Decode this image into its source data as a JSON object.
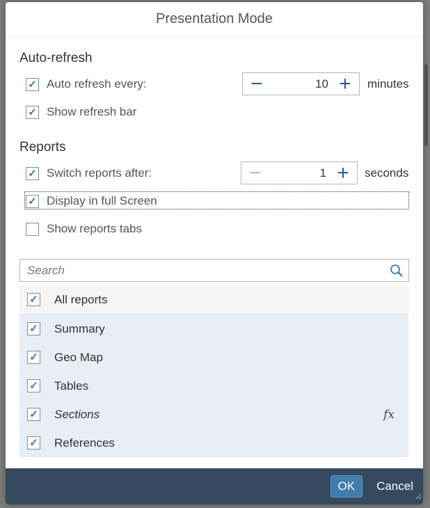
{
  "dialog": {
    "title": "Presentation Mode"
  },
  "auto_refresh": {
    "section_title": "Auto-refresh",
    "auto_refresh_every": {
      "label": "Auto refresh every:",
      "checked": true
    },
    "interval": {
      "value": "10",
      "unit": "minutes"
    },
    "show_refresh_bar": {
      "label": "Show refresh bar",
      "checked": true
    }
  },
  "reports": {
    "section_title": "Reports",
    "switch_reports_after": {
      "label": "Switch reports after:",
      "checked": true
    },
    "interval": {
      "value": "1",
      "unit": "seconds"
    },
    "display_full_screen": {
      "label": "Display in full Screen",
      "checked": true
    },
    "show_reports_tabs": {
      "label": "Show reports tabs",
      "checked": false
    }
  },
  "search": {
    "placeholder": "Search"
  },
  "report_list": {
    "all": {
      "label": "All reports",
      "checked": true
    },
    "items": [
      {
        "label": "Summary",
        "checked": true
      },
      {
        "label": "Geo Map",
        "checked": true
      },
      {
        "label": "Tables",
        "checked": true
      },
      {
        "label": "Sections",
        "checked": true,
        "italic": true,
        "icon": "fx-icon"
      },
      {
        "label": "References",
        "checked": true
      }
    ]
  },
  "footer": {
    "ok_label": "OK",
    "cancel_label": "Cancel"
  },
  "colors": {
    "accent": "#427cac",
    "footer_bg": "#354a5f",
    "list_selected_bg": "#e7eef5"
  }
}
